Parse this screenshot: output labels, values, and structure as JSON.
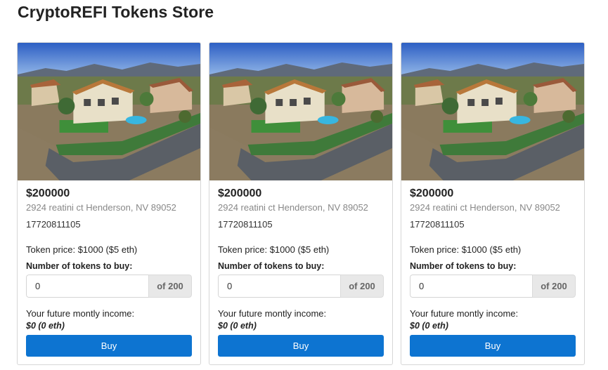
{
  "page": {
    "title": "CryptoREFI Tokens Store"
  },
  "cards": [
    {
      "price": "$200000",
      "address": "2924 reatini ct Henderson, NV 89052",
      "phone": "17720811105",
      "token_price": "Token price: $1000 ($5 eth)",
      "tokens_label": "Number of tokens to buy:",
      "quantity": "0",
      "of_total": "of 200",
      "income_label": "Your future montly income:",
      "income_value": "$0 (0 eth)",
      "buy_label": "Buy"
    },
    {
      "price": "$200000",
      "address": "2924 reatini ct Henderson, NV 89052",
      "phone": "17720811105",
      "token_price": "Token price: $1000 ($5 eth)",
      "tokens_label": "Number of tokens to buy:",
      "quantity": "0",
      "of_total": "of 200",
      "income_label": "Your future montly income:",
      "income_value": "$0 (0 eth)",
      "buy_label": "Buy"
    },
    {
      "price": "$200000",
      "address": "2924 reatini ct Henderson, NV 89052",
      "phone": "17720811105",
      "token_price": "Token price: $1000 ($5 eth)",
      "tokens_label": "Number of tokens to buy:",
      "quantity": "0",
      "of_total": "of 200",
      "income_label": "Your future montly income:",
      "income_value": "$0 (0 eth)",
      "buy_label": "Buy"
    }
  ],
  "colors": {
    "buy_button": "#0d74d1",
    "addon_bg": "#e8e8e8",
    "address_text": "#888888"
  }
}
